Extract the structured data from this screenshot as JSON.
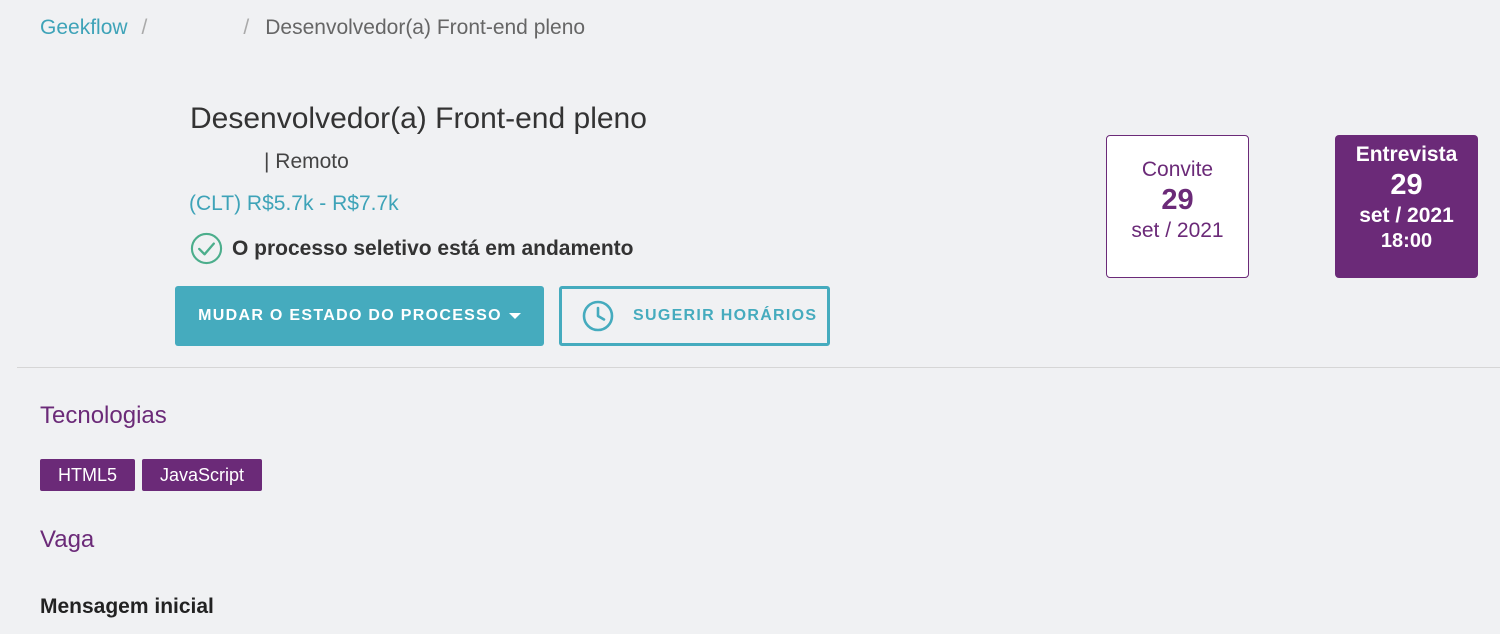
{
  "breadcrumb": {
    "home": "Geekflow",
    "separator": "/",
    "current": "Desenvolvedor(a) Front-end pleno"
  },
  "job": {
    "title": "Desenvolvedor(a) Front-end pleno",
    "location": "| Remoto",
    "salary": "(CLT) R$5.7k - R$7.7k",
    "status": "O processo seletivo está em andamento"
  },
  "buttons": {
    "change_state": "MUDAR O ESTADO DO PROCESSO",
    "suggest_times": "SUGERIR HORÁRIOS"
  },
  "invite_card": {
    "label": "Convite",
    "day": "29",
    "month_year": "set / 2021"
  },
  "interview_card": {
    "label": "Entrevista",
    "day": "29",
    "month_year": "set / 2021",
    "time": "18:00"
  },
  "sections": {
    "technologies": "Tecnologias",
    "job": "Vaga",
    "initial_message": "Mensagem inicial"
  },
  "technologies": [
    "HTML5",
    "JavaScript"
  ],
  "icons": {
    "status": "check-circle-icon",
    "suggest": "clock-icon",
    "dropdown": "caret-down-icon"
  },
  "colors": {
    "accent": "#45abbe",
    "brand": "#6b2a78",
    "success": "#4cae8c"
  }
}
